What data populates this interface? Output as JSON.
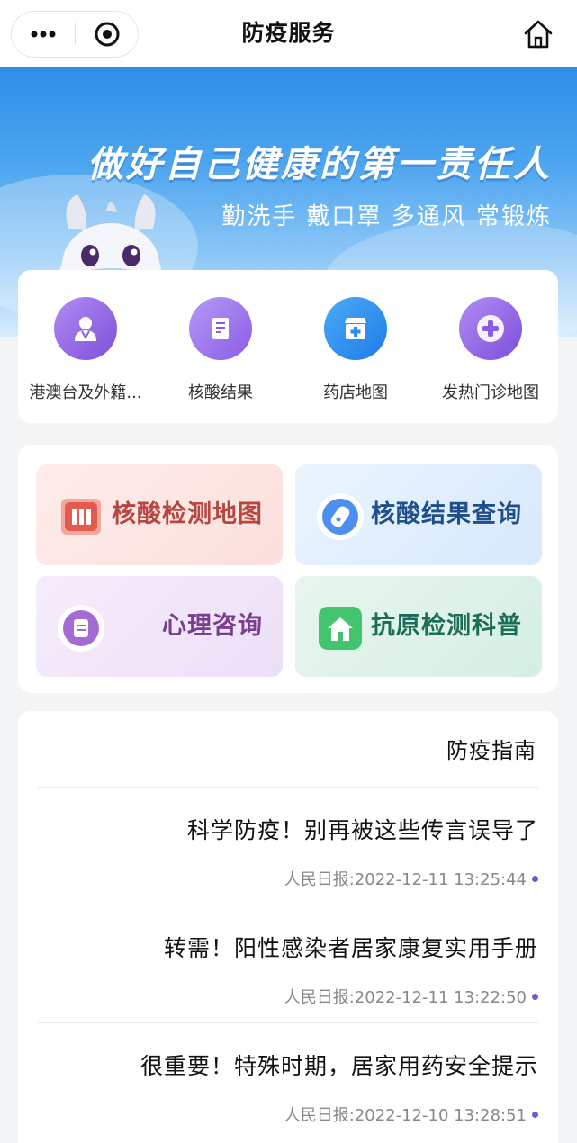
{
  "header": {
    "title": "防疫服务",
    "capsule": {
      "record_icon": "record-circle-icon",
      "more_icon": "more-dots-icon"
    },
    "home_icon": "home-icon"
  },
  "banner": {
    "headline": "做好自己健康的第一责任人",
    "subline": "勤洗手 戴口罩 多通风 常锻炼"
  },
  "quick_entries": [
    {
      "label": "发热门诊地图",
      "icon": "fever-clinic-icon",
      "color": "#8a5ce6"
    },
    {
      "label": "药店地图",
      "icon": "pharmacy-icon",
      "color": "#2d8cf0"
    },
    {
      "label": "核酸结果",
      "icon": "test-report-icon",
      "color": "#9a6ae6"
    },
    {
      "label": "港澳台及外籍...",
      "icon": "doctor-icon",
      "color": "#8a5ce6"
    }
  ],
  "tiles": [
    {
      "label": "核酸结果查询",
      "icon": "test-tube-icon",
      "color": "#1f4f8a"
    },
    {
      "label": "核酸检测地图",
      "icon": "map-book-icon",
      "color": "#b8453f"
    },
    {
      "label": "抗原检测科普",
      "icon": "house-icon",
      "color": "#1c6e58"
    },
    {
      "label": "心理咨询",
      "icon": "note-icon",
      "color": "#7a3f8f"
    }
  ],
  "guide": {
    "title": "防疫指南",
    "articles": [
      {
        "title": "科学防疫！别再被这些传言误导了",
        "meta": "人民日报:2022-12-11 13:25:44"
      },
      {
        "title": "转需！阳性感染者居家康复实用手册",
        "meta": "人民日报:2022-12-11 13:22:50"
      },
      {
        "title": "很重要！特殊时期，居家用药安全提示",
        "meta": "人民日报:2022-12-10 13:28:51"
      }
    ]
  },
  "colors": {
    "accent_purple": "#6f5bd6",
    "accent_blue": "#2d8cf0"
  }
}
